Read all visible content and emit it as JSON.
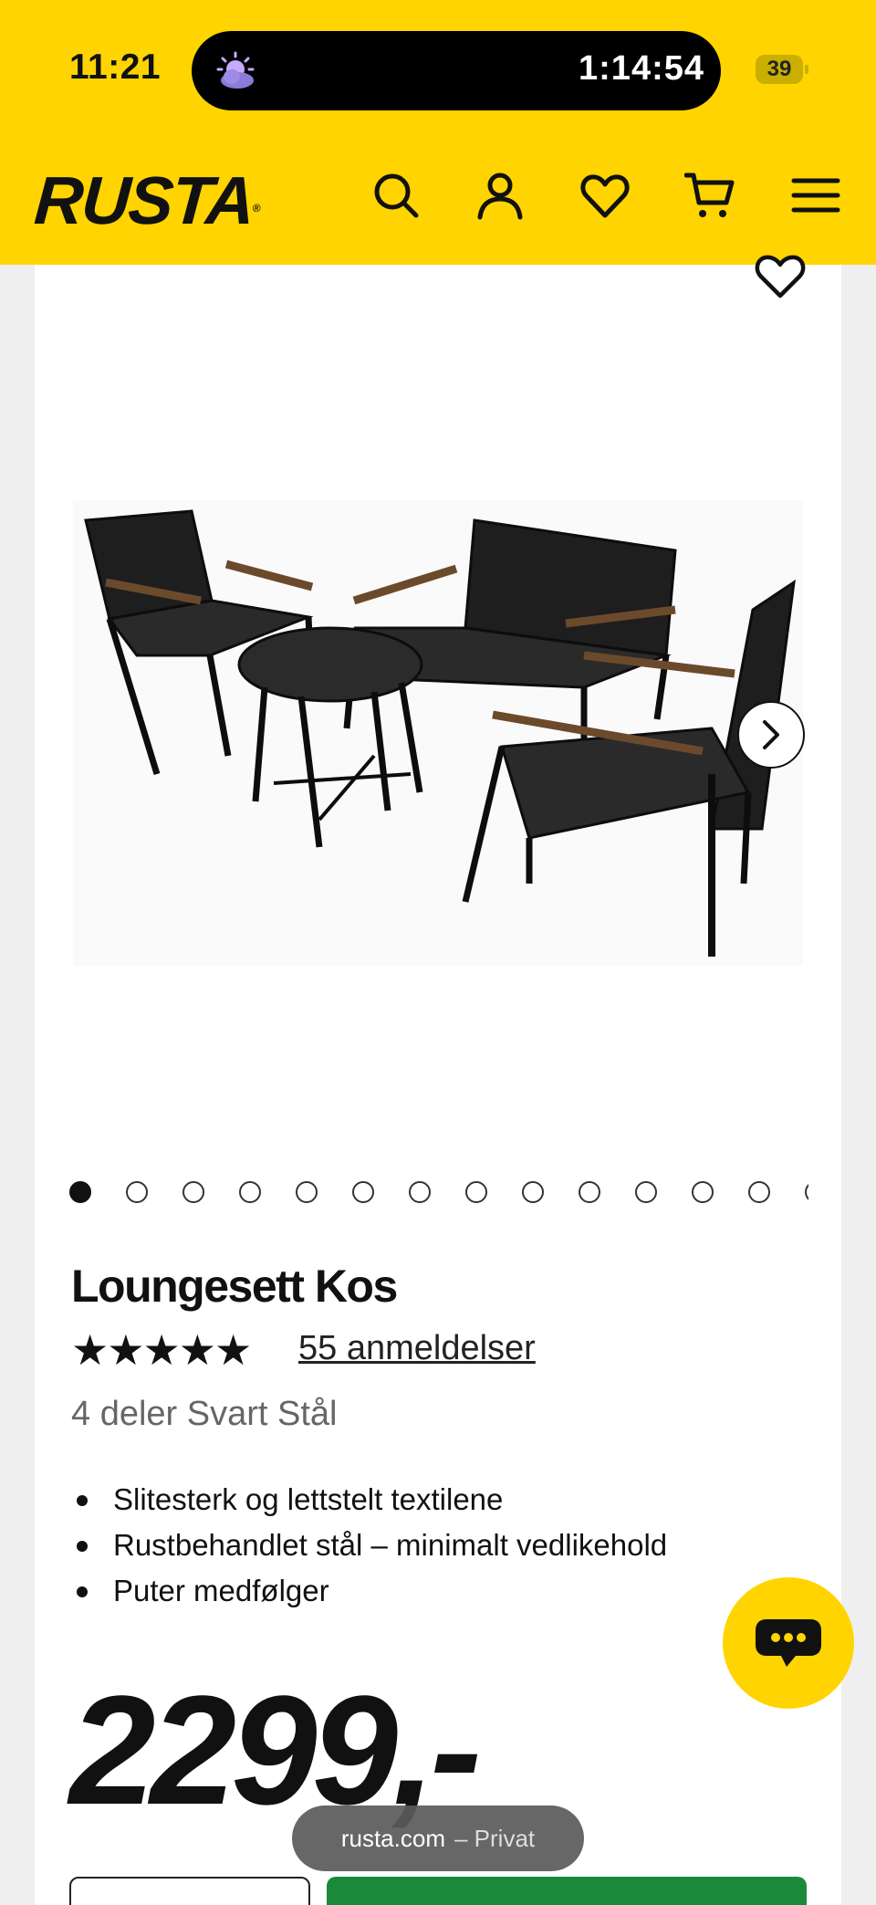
{
  "status_bar": {
    "time": "11:21",
    "timer": "1:14:54",
    "battery": "39"
  },
  "header": {
    "logo": "RUSTA",
    "icons": [
      "search-icon",
      "account-icon",
      "heart-icon",
      "cart-icon",
      "menu-icon"
    ],
    "background_color": "#ffd400"
  },
  "product": {
    "title": "Loungesett Kos",
    "rating_stars": "★★★★★",
    "rating": 5,
    "reviews_label": "55 anmeldelser",
    "subtitle": "4 deler Svart Stål",
    "features": [
      "Slitesterk og lettstelt textilene",
      "Rustbehandlet stål – minimalt vedlikehold",
      "Puter medfølger"
    ],
    "price": "2299,-",
    "gallery": {
      "current_index": 1,
      "dots_visible": 14
    }
  },
  "browser": {
    "domain": "rusta.com",
    "mode": "– Privat"
  },
  "colors": {
    "brand_yellow": "#ffd400",
    "buy_green": "#1a8a3a"
  }
}
